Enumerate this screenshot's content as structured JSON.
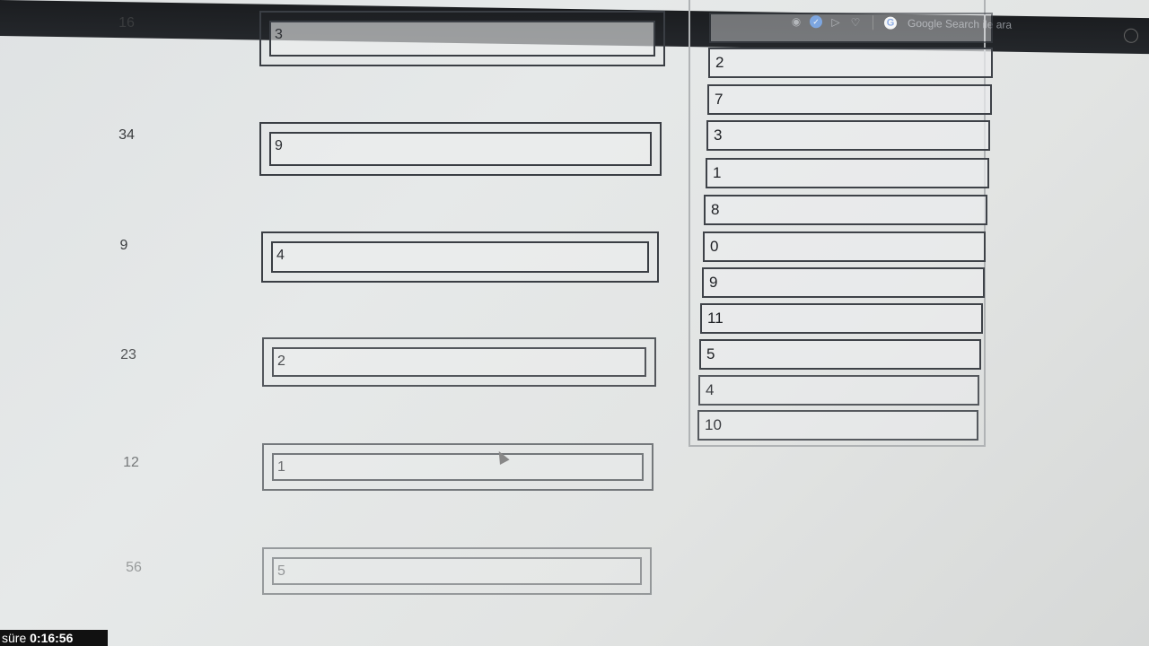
{
  "browser_bar": {
    "search_label": "Google Search ile ara",
    "icons": [
      "camera-icon",
      "shield-check-icon",
      "play-icon",
      "heart-icon",
      "google-icon"
    ]
  },
  "questions": [
    {
      "label": "16",
      "answer": "3"
    },
    {
      "label": "34",
      "answer": "9"
    },
    {
      "label": "9",
      "answer": "4"
    },
    {
      "label": "23",
      "answer": "2"
    },
    {
      "label": "12",
      "answer": "1"
    },
    {
      "label": "56",
      "answer": "5"
    }
  ],
  "options": [
    "2",
    "7",
    "3",
    "1",
    "8",
    "0",
    "9",
    "11",
    "5",
    "4",
    "10"
  ],
  "timer": {
    "prefix": "süre",
    "value": "0:16:56"
  }
}
